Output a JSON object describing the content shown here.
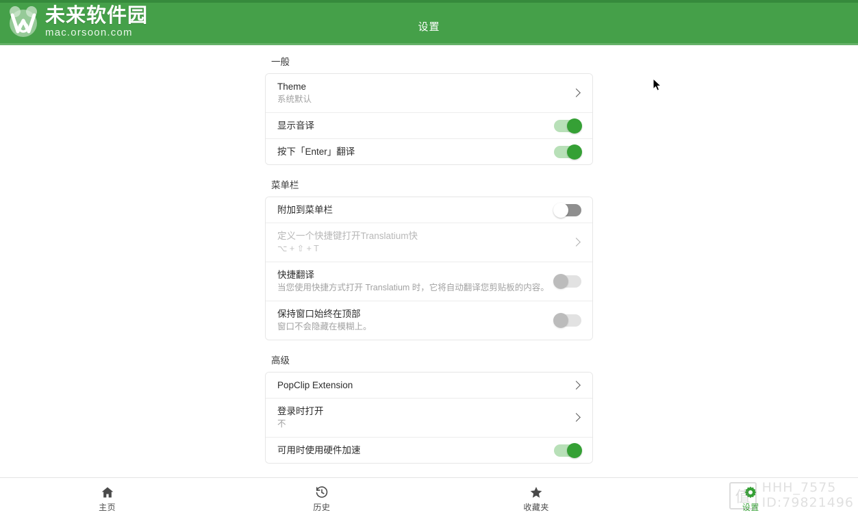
{
  "header": {
    "title": "设置",
    "brand_cn": "未来软件园",
    "brand_url": "mac.orsoon.com",
    "brand_color": "#45a049",
    "brand_top_stripe": "#368a3c"
  },
  "sections": [
    {
      "title": "一般",
      "rows": [
        {
          "title": "Theme",
          "sub": "系统默认",
          "control": "chevron"
        },
        {
          "title": "显示音译",
          "sub": "",
          "control": "toggle-on"
        },
        {
          "title": "按下「Enter」翻译",
          "sub": "",
          "control": "toggle-on"
        }
      ]
    },
    {
      "title": "菜单栏",
      "rows": [
        {
          "title": "附加到菜单栏",
          "sub": "",
          "control": "toggle-off"
        },
        {
          "title": "定义一个快捷键打开Translatium快",
          "sub": "⌥ + ⇧ + T",
          "control": "chevron-light",
          "dim": true
        },
        {
          "title": "快捷翻译",
          "sub": "当您使用快捷方式打开 Translatium 时，它将自动翻译您剪贴板的内容。",
          "control": "toggle-disabled"
        },
        {
          "title": "保持窗口始终在顶部",
          "sub": "窗口不会隐藏在模糊上。",
          "control": "toggle-disabled"
        }
      ]
    },
    {
      "title": "高级",
      "rows": [
        {
          "title": "PopClip Extension",
          "sub": "",
          "control": "chevron"
        },
        {
          "title": "登录时打开",
          "sub": "不",
          "control": "chevron"
        },
        {
          "title": "可用时使用硬件加速",
          "sub": "",
          "control": "toggle-on"
        }
      ]
    }
  ],
  "tabs": [
    {
      "label": "主页",
      "icon": "home-icon",
      "active": false
    },
    {
      "label": "历史",
      "icon": "history-clock-icon",
      "active": false
    },
    {
      "label": "收藏夹",
      "icon": "star-icon",
      "active": false
    },
    {
      "label": "设置",
      "icon": "gear-icon",
      "active": true
    }
  ],
  "watermark": {
    "badge": "值",
    "name": "HHH_7575",
    "id": "ID:79821496"
  },
  "accent_color": "#35a035"
}
